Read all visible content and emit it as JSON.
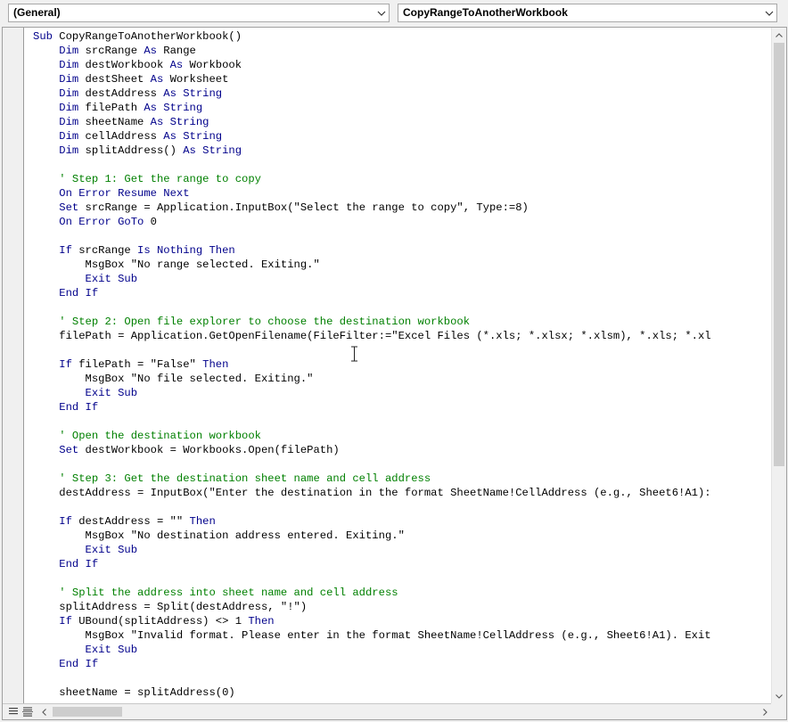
{
  "object_combo": {
    "value": "(General)"
  },
  "procedure_combo": {
    "value": "CopyRangeToAnotherWorkbook"
  },
  "icons": {
    "dropdown": "chevron-down-icon",
    "procedure_view": "procedure-view-icon",
    "module_view": "full-module-view-icon",
    "cursor": "i-beam-cursor-icon"
  },
  "colors": {
    "keyword": "#00008b",
    "comment": "#008000",
    "text": "#000000",
    "background": "#ffffff"
  },
  "code_lines": [
    [
      [
        "kw",
        "Sub "
      ],
      [
        "tx",
        "CopyRangeToAnotherWorkbook()"
      ]
    ],
    [
      [
        "kw",
        "    Dim "
      ],
      [
        "tx",
        "srcRange "
      ],
      [
        "kw",
        "As "
      ],
      [
        "tx",
        "Range"
      ]
    ],
    [
      [
        "kw",
        "    Dim "
      ],
      [
        "tx",
        "destWorkbook "
      ],
      [
        "kw",
        "As "
      ],
      [
        "tx",
        "Workbook"
      ]
    ],
    [
      [
        "kw",
        "    Dim "
      ],
      [
        "tx",
        "destSheet "
      ],
      [
        "kw",
        "As "
      ],
      [
        "tx",
        "Worksheet"
      ]
    ],
    [
      [
        "kw",
        "    Dim "
      ],
      [
        "tx",
        "destAddress "
      ],
      [
        "kw",
        "As String"
      ]
    ],
    [
      [
        "kw",
        "    Dim "
      ],
      [
        "tx",
        "filePath "
      ],
      [
        "kw",
        "As String"
      ]
    ],
    [
      [
        "kw",
        "    Dim "
      ],
      [
        "tx",
        "sheetName "
      ],
      [
        "kw",
        "As String"
      ]
    ],
    [
      [
        "kw",
        "    Dim "
      ],
      [
        "tx",
        "cellAddress "
      ],
      [
        "kw",
        "As String"
      ]
    ],
    [
      [
        "kw",
        "    Dim "
      ],
      [
        "tx",
        "splitAddress() "
      ],
      [
        "kw",
        "As String"
      ]
    ],
    [
      [
        "tx",
        ""
      ]
    ],
    [
      [
        "cm",
        "    ' Step 1: Get the range to copy"
      ]
    ],
    [
      [
        "kw",
        "    On Error Resume Next"
      ]
    ],
    [
      [
        "kw",
        "    Set "
      ],
      [
        "tx",
        "srcRange = Application.InputBox(\"Select the range to copy\", Type:=8)"
      ]
    ],
    [
      [
        "kw",
        "    On Error GoTo "
      ],
      [
        "tx",
        "0"
      ]
    ],
    [
      [
        "tx",
        ""
      ]
    ],
    [
      [
        "kw",
        "    If "
      ],
      [
        "tx",
        "srcRange "
      ],
      [
        "kw",
        "Is Nothing Then"
      ]
    ],
    [
      [
        "tx",
        "        MsgBox \"No range selected. Exiting.\""
      ]
    ],
    [
      [
        "kw",
        "        Exit Sub"
      ]
    ],
    [
      [
        "kw",
        "    End If"
      ]
    ],
    [
      [
        "tx",
        ""
      ]
    ],
    [
      [
        "cm",
        "    ' Step 2: Open file explorer to choose the destination workbook"
      ]
    ],
    [
      [
        "tx",
        "    filePath = Application.GetOpenFilename(FileFilter:=\"Excel Files (*.xls; *.xlsx; *.xlsm), *.xls; *.xl"
      ]
    ],
    [
      [
        "tx",
        ""
      ]
    ],
    [
      [
        "kw",
        "    If "
      ],
      [
        "tx",
        "filePath = \"False\" "
      ],
      [
        "kw",
        "Then"
      ]
    ],
    [
      [
        "tx",
        "        MsgBox \"No file selected. Exiting.\""
      ]
    ],
    [
      [
        "kw",
        "        Exit Sub"
      ]
    ],
    [
      [
        "kw",
        "    End If"
      ]
    ],
    [
      [
        "tx",
        ""
      ]
    ],
    [
      [
        "cm",
        "    ' Open the destination workbook"
      ]
    ],
    [
      [
        "kw",
        "    Set "
      ],
      [
        "tx",
        "destWorkbook = Workbooks.Open(filePath)"
      ]
    ],
    [
      [
        "tx",
        ""
      ]
    ],
    [
      [
        "cm",
        "    ' Step 3: Get the destination sheet name and cell address"
      ]
    ],
    [
      [
        "tx",
        "    destAddress = InputBox(\"Enter the destination in the format SheetName!CellAddress (e.g., Sheet6!A1):"
      ]
    ],
    [
      [
        "tx",
        ""
      ]
    ],
    [
      [
        "kw",
        "    If "
      ],
      [
        "tx",
        "destAddress = \"\" "
      ],
      [
        "kw",
        "Then"
      ]
    ],
    [
      [
        "tx",
        "        MsgBox \"No destination address entered. Exiting.\""
      ]
    ],
    [
      [
        "kw",
        "        Exit Sub"
      ]
    ],
    [
      [
        "kw",
        "    End If"
      ]
    ],
    [
      [
        "tx",
        ""
      ]
    ],
    [
      [
        "cm",
        "    ' Split the address into sheet name and cell address"
      ]
    ],
    [
      [
        "tx",
        "    splitAddress = Split(destAddress, \"!\")"
      ]
    ],
    [
      [
        "kw",
        "    If "
      ],
      [
        "tx",
        "UBound(splitAddress) <> 1 "
      ],
      [
        "kw",
        "Then"
      ]
    ],
    [
      [
        "tx",
        "        MsgBox \"Invalid format. Please enter in the format SheetName!CellAddress (e.g., Sheet6!A1). Exit"
      ]
    ],
    [
      [
        "kw",
        "        Exit Sub"
      ]
    ],
    [
      [
        "kw",
        "    End If"
      ]
    ],
    [
      [
        "tx",
        ""
      ]
    ],
    [
      [
        "tx",
        "    sheetName = splitAddress(0)"
      ]
    ]
  ]
}
